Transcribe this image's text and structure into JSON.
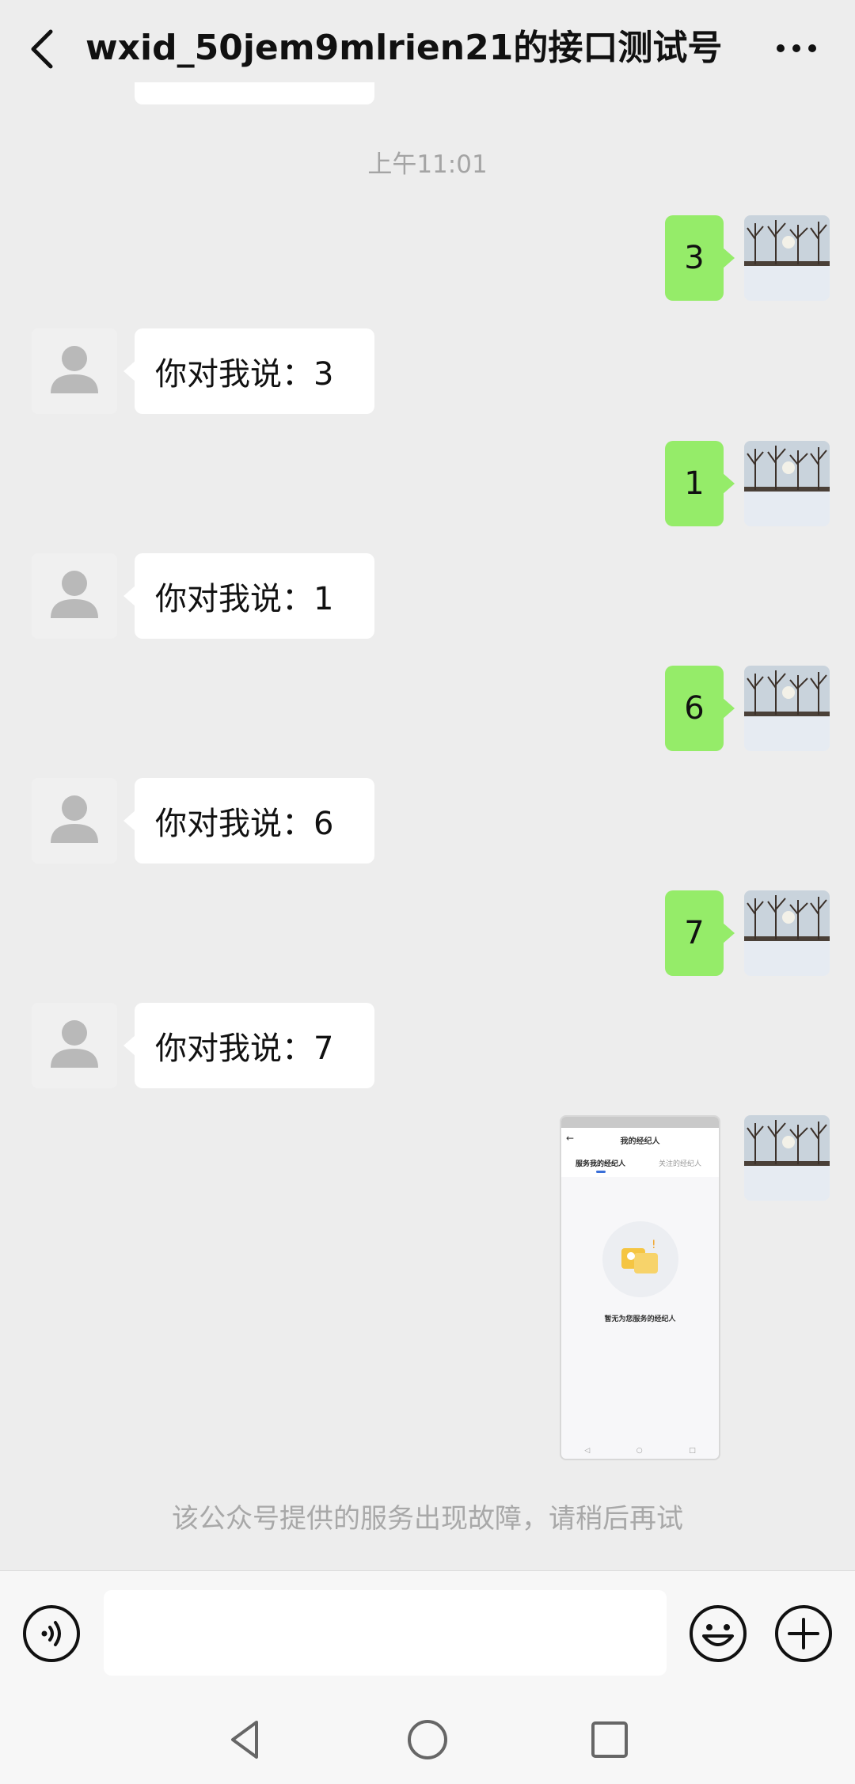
{
  "header": {
    "title": "wxid_50jem9mlrien21的接口测试号"
  },
  "timestamp": "上午11:01",
  "messages": [
    {
      "from": "me",
      "text": "3"
    },
    {
      "from": "bot",
      "text": "你对我说：3"
    },
    {
      "from": "me",
      "text": "1"
    },
    {
      "from": "bot",
      "text": "你对我说：1"
    },
    {
      "from": "me",
      "text": "6"
    },
    {
      "from": "bot",
      "text": "你对我说：6"
    },
    {
      "from": "me",
      "text": "7"
    },
    {
      "from": "bot",
      "text": "你对我说：7"
    }
  ],
  "screenshot_message": {
    "nav_title": "我的经纪人",
    "tab_active": "服务我的经纪人",
    "tab_inactive": "关注的经纪人",
    "empty_text": "暂无为您服务的经纪人"
  },
  "notice": "该公众号提供的服务出现故障，请稍后再试",
  "input": {
    "value": "",
    "placeholder": ""
  },
  "icons": {
    "back": "back-chevron-icon",
    "more": "more-dots-icon",
    "voice": "voice-icon",
    "emoji": "emoji-icon",
    "plus": "plus-icon"
  },
  "colors": {
    "my_bubble": "#95ec69",
    "bot_bubble": "#ffffff",
    "background": "#ededed"
  }
}
